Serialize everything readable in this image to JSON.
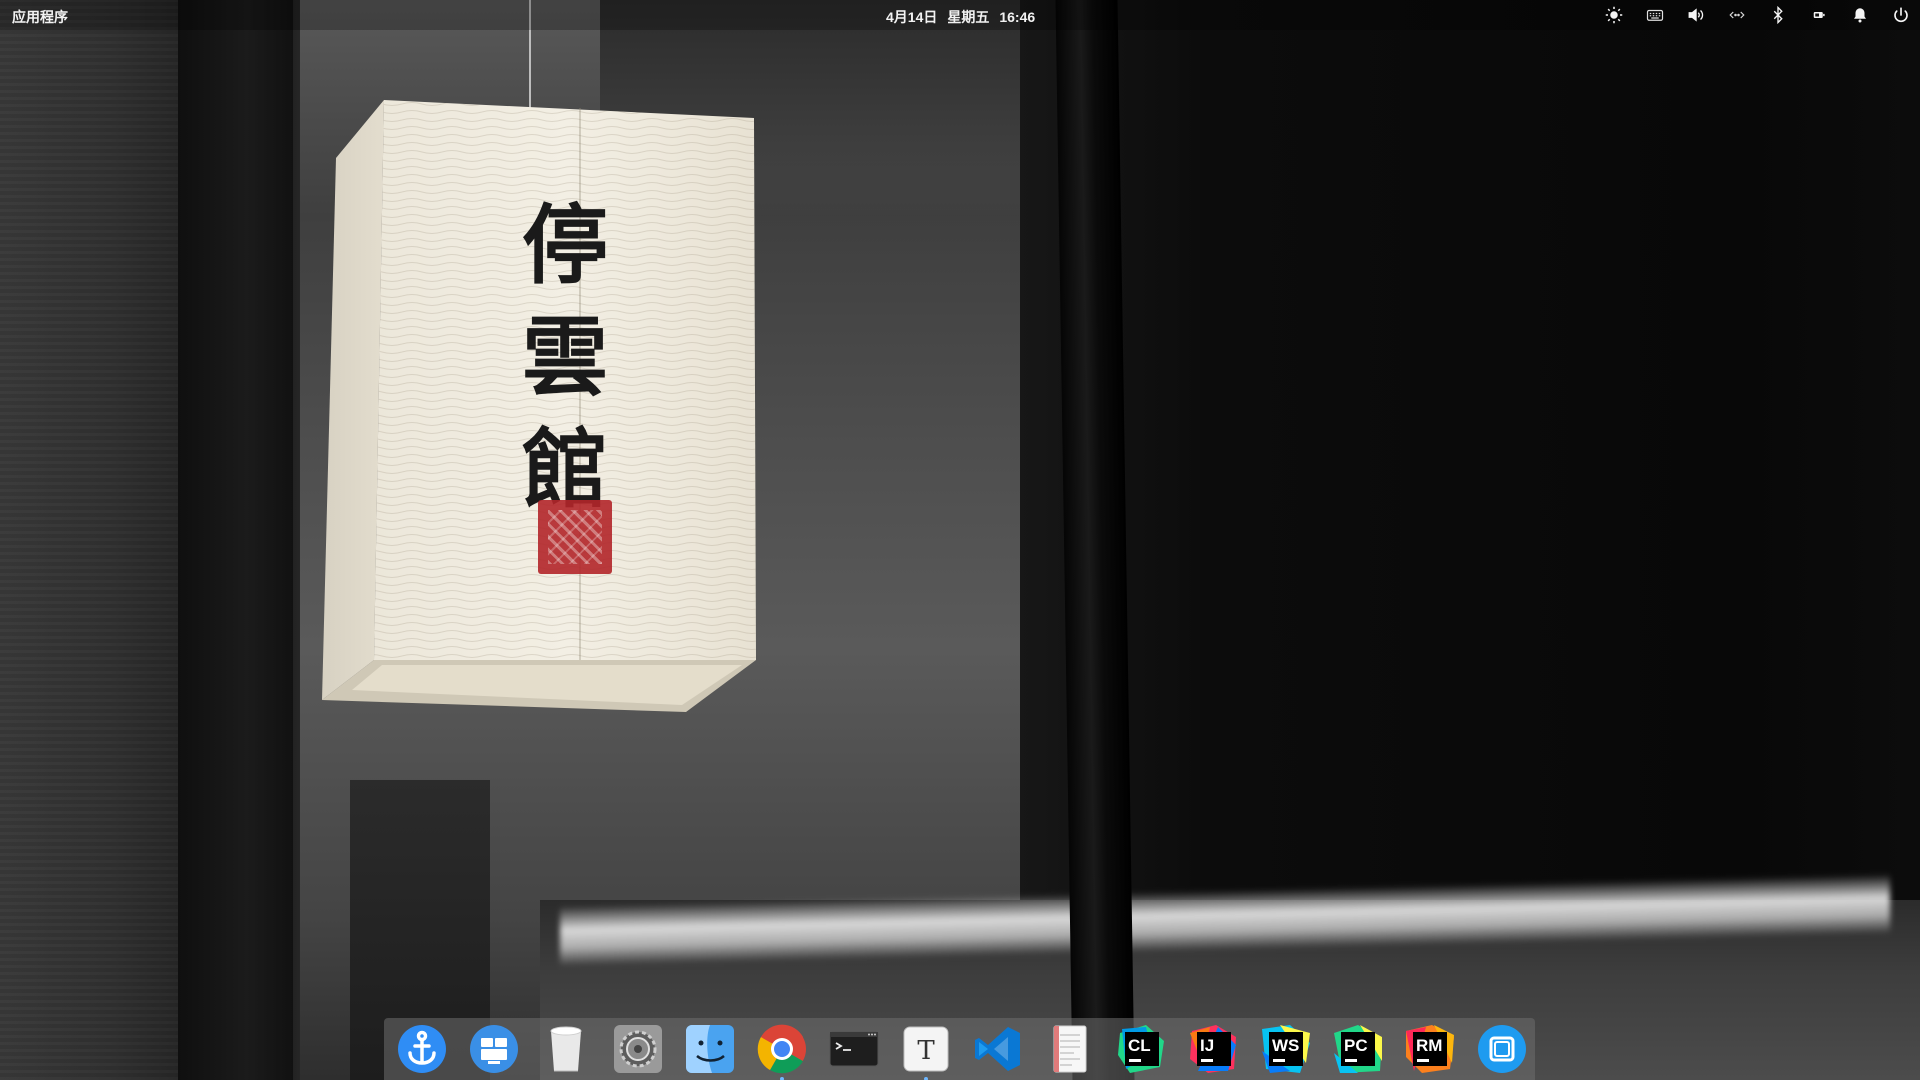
{
  "top_bar": {
    "app_menu_label": "应用程序",
    "date": "4月14日",
    "weekday": "星期五",
    "time": "16:46",
    "tray_icons": [
      "brightness-icon",
      "keyboard-icon",
      "volume-icon",
      "network-icon",
      "bluetooth-icon",
      "battery-icon",
      "notification-bell-icon",
      "power-icon"
    ]
  },
  "wallpaper": {
    "lantern_text": "停云馆",
    "lantern_chars": [
      "停",
      "雲",
      "館"
    ]
  },
  "dock": {
    "apps": [
      {
        "icon": "anchor-icon",
        "color": "#2f8df5"
      },
      {
        "icon": "workspaces-icon",
        "color": "#3a8fe6"
      },
      {
        "icon": "trash-icon",
        "color": "#e8e8e8"
      },
      {
        "icon": "settings-gear-icon",
        "color": "#8c8c8c"
      },
      {
        "icon": "finder-icon",
        "color": "#4aa3f0"
      },
      {
        "icon": "chrome-icon",
        "color": "#db4437"
      },
      {
        "icon": "terminal-icon",
        "color": "#1e1e1e"
      },
      {
        "icon": "typora-icon",
        "color": "#f2f2f2"
      },
      {
        "icon": "vscode-icon",
        "color": "#0a78d4"
      },
      {
        "icon": "document-viewer-icon",
        "color": "#f4f4f4"
      },
      {
        "icon": "clion-icon",
        "label": "CL",
        "color": "#21d789"
      },
      {
        "icon": "intellij-icon",
        "label": "IJ",
        "color": "#fe315d"
      },
      {
        "icon": "webstorm-icon",
        "label": "WS",
        "color": "#07c3f2"
      },
      {
        "icon": "pycharm-icon",
        "label": "PC",
        "color": "#21d789"
      },
      {
        "icon": "rubymine-icon",
        "label": "RM",
        "color": "#fc801d"
      },
      {
        "icon": "window-manager-icon",
        "color": "#1e9bf0"
      }
    ]
  }
}
